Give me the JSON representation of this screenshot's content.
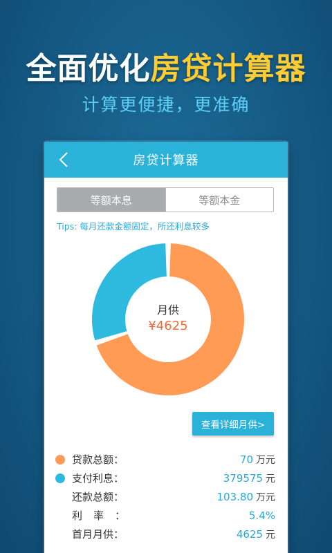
{
  "promo": {
    "title_part1": "全面优化",
    "title_part2": "房贷计算器",
    "subtitle": "计算更便捷，更准确"
  },
  "app": {
    "title": "房贷计算器"
  },
  "tabs": [
    {
      "label": "等额本息",
      "active": true
    },
    {
      "label": "等额本金",
      "active": false
    }
  ],
  "tips": "Tips: 每月还款金额固定，所还利息较多",
  "donut": {
    "label": "月供",
    "value": "¥4625",
    "principal_fraction": 0.7,
    "interest_fraction": 0.3,
    "colors": {
      "principal": "#ff9b55",
      "interest": "#2eb9de"
    }
  },
  "detail_button": "查看详细月供>",
  "summary": [
    {
      "label": "贷款总额：",
      "value": "70",
      "unit": "万元",
      "dot": "#ff9b55"
    },
    {
      "label": "支付利息：",
      "value": "379575",
      "unit": "元",
      "dot": "#2eb9de"
    },
    {
      "label": "还款总额：",
      "value": "103.80",
      "unit": "万元",
      "dot": ""
    },
    {
      "label": "利率：",
      "value": "5.4%",
      "unit": "",
      "dot": ""
    },
    {
      "label": "首月月供：",
      "value": "4625",
      "unit": "元",
      "dot": ""
    }
  ]
}
